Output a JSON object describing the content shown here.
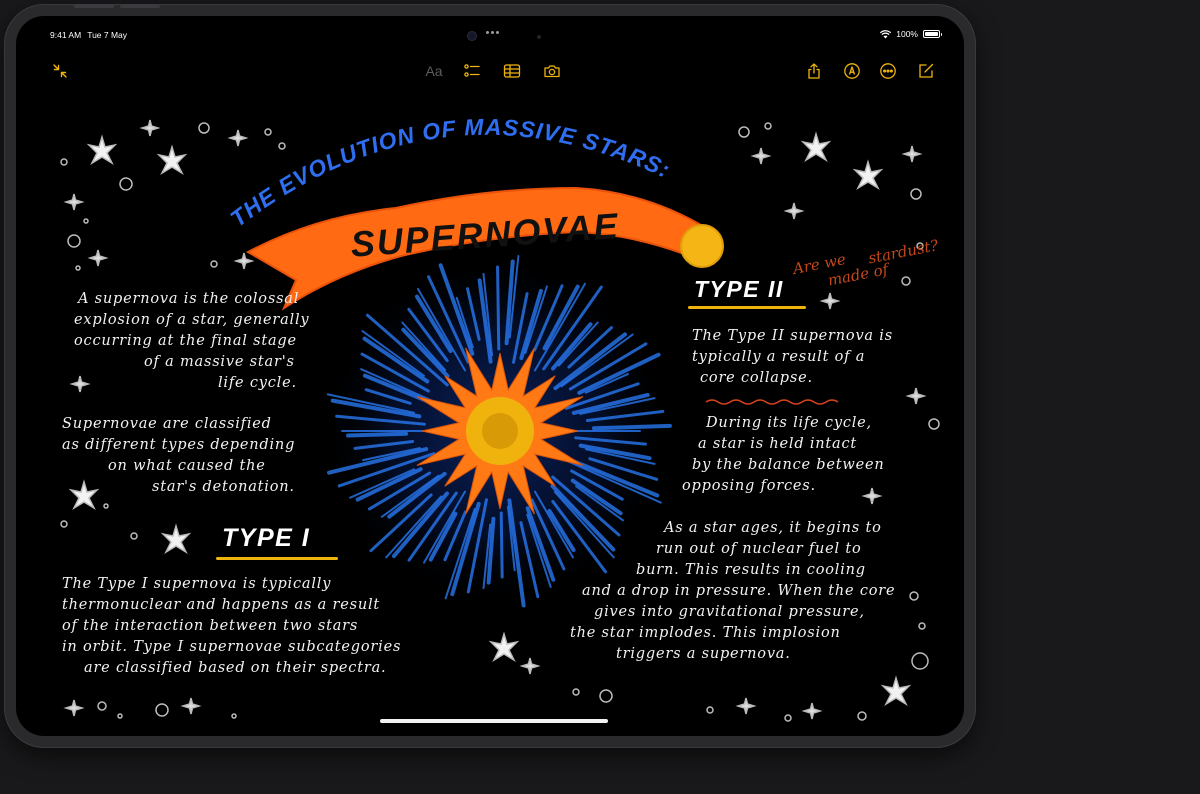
{
  "status_bar": {
    "time": "9:41 AM",
    "date": "Tue 7 May",
    "battery": "100%",
    "battery_level": 1.0
  },
  "toolbar": {
    "collapse_icon": "arrows-collapse-icon",
    "format_label": "Aa",
    "checklist_icon": "checklist-icon",
    "table_icon": "table-icon",
    "camera_icon": "camera-icon",
    "share_icon": "share-icon",
    "markup_icon": "pen-markup-icon",
    "more_icon": "ellipsis-circle-icon",
    "compose_icon": "compose-icon",
    "accent": "#f0b50c"
  },
  "note": {
    "arc_title": "THE EVOLUTION OF MASSIVE STARS:",
    "banner_title": "SUPERNOVAE",
    "side_question": [
      "Are we",
      "made of",
      "stardust?"
    ],
    "intro_lines": [
      "A supernova is the colossal",
      "explosion of a star, generally",
      "occurring at the final stage",
      "of a massive star's",
      "life cycle."
    ],
    "classified_lines": [
      "Supernovae are classified",
      "as different types depending",
      "on what caused the",
      "star's detonation."
    ],
    "type1_heading": "TYPE I",
    "type1_lines": [
      "The Type I supernova is typically",
      "thermonuclear and happens as a result",
      "of the interaction between two stars",
      "in orbit. Type I supernovae subcategories",
      "are classified based on their spectra."
    ],
    "type2_heading": "TYPE II",
    "type2_lines": [
      "The Type II supernova is",
      "typically a result of a",
      "core collapse."
    ],
    "lifecycle_lines": [
      "During its life cycle,",
      "a star is held intact",
      "by the balance between",
      "opposing forces."
    ],
    "aging_lines": [
      "As a star ages, it begins to",
      "run out of nuclear fuel to",
      "burn. This results in cooling",
      "and a drop in pressure. When the core",
      "gives into gravitational pressure,",
      "the star implodes. This implosion",
      "triggers a supernova."
    ],
    "colors": {
      "title_blue": "#2f6ef0",
      "banner_orange": "#ff6a12",
      "sun_yellow": "#f5b515",
      "burst_blue": "#2a7fff",
      "burst_orange": "#ff7a14",
      "core_yellow": "#f0b20c",
      "question_orange": "#c4471a",
      "heading_underline": "#f0b50c"
    }
  }
}
